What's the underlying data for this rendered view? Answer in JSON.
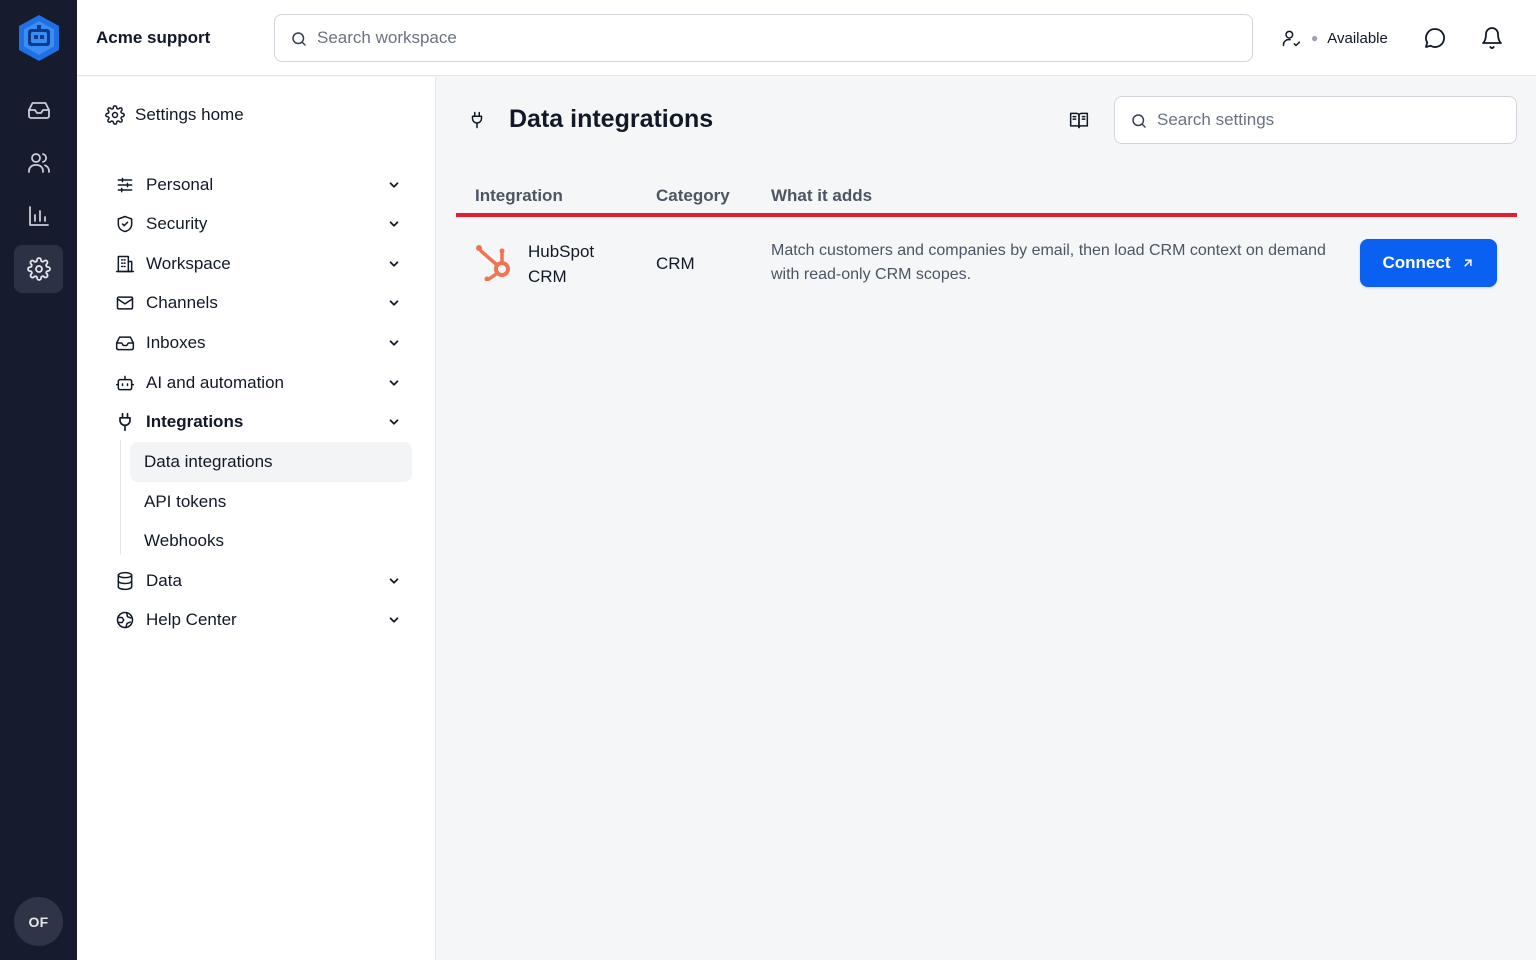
{
  "rail": {
    "avatar_initials": "OF",
    "items": [
      {
        "icon": "inbox-icon"
      },
      {
        "icon": "users-icon"
      },
      {
        "icon": "bar-chart-icon"
      },
      {
        "icon": "gear-icon",
        "active": true
      }
    ]
  },
  "topbar": {
    "workspace_name": "Acme support",
    "search_placeholder": "Search workspace",
    "status_label": "Available"
  },
  "nav": {
    "home_label": "Settings home",
    "items": [
      {
        "label": "Personal",
        "icon": "sliders-icon"
      },
      {
        "label": "Security",
        "icon": "shield-icon"
      },
      {
        "label": "Workspace",
        "icon": "building-icon"
      },
      {
        "label": "Channels",
        "icon": "envelope-icon"
      },
      {
        "label": "Inboxes",
        "icon": "inbox-icon"
      },
      {
        "label": "AI and automation",
        "icon": "bot-icon"
      },
      {
        "label": "Integrations",
        "icon": "plug-icon",
        "expanded": true
      },
      {
        "label": "Data",
        "icon": "database-icon"
      },
      {
        "label": "Help Center",
        "icon": "globe-icon"
      }
    ],
    "sub_items": [
      {
        "label": "Data integrations",
        "active": true
      },
      {
        "label": "API tokens"
      },
      {
        "label": "Webhooks"
      }
    ]
  },
  "main": {
    "title": "Data integrations",
    "search_placeholder": "Search settings",
    "columns": [
      "Integration",
      "Category",
      "What it adds"
    ],
    "rows": [
      {
        "integration": "HubSpot CRM",
        "category": "CRM",
        "description": "Match customers and companies by email, then load CRM context on demand with read-only CRM scopes.",
        "action_label": "Connect"
      }
    ]
  },
  "colors": {
    "rail_bg": "#171b2e",
    "accent": "#0a60f0",
    "hubspot": "#f0744f",
    "header_rule": "#e11d2e"
  }
}
